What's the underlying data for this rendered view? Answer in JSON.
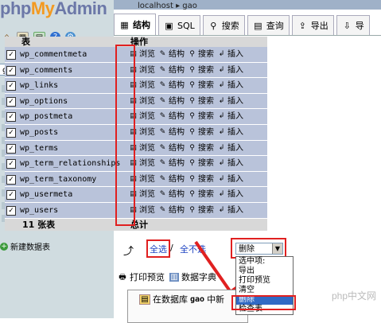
{
  "app": {
    "logo": {
      "part1": "php",
      "part2": "My",
      "part3": "Admin"
    },
    "nav_icons": [
      "home-icon",
      "table-icon",
      "query-icon",
      "help-icon",
      "settings-icon"
    ]
  },
  "left": {
    "db_selector": {
      "value": "gao"
    },
    "tables": [
      "wp_commentmeta",
      "wp_comments",
      "wp_links",
      "wp_options",
      "wp_postmeta",
      "wp_posts",
      "wp_terms",
      "wp_term_relationships",
      "wp_term_taxonomy",
      "wp_usermeta",
      "wp_users"
    ],
    "new_table": "新建数据表"
  },
  "right": {
    "breadcrumb": "localhost  ▸  gao",
    "tabs": [
      {
        "label": "结构",
        "icon": "structure-icon",
        "active": true
      },
      {
        "label": "SQL",
        "icon": "sql-icon"
      },
      {
        "label": "搜索",
        "icon": "search-icon"
      },
      {
        "label": "查询",
        "icon": "query-icon"
      },
      {
        "label": "导出",
        "icon": "export-icon"
      },
      {
        "label": "导",
        "icon": "import-icon"
      }
    ],
    "table_header": {
      "col_table": "表",
      "col_ops": "操作"
    },
    "rows": [
      {
        "name": "wp_commentmeta",
        "checked": true
      },
      {
        "name": "wp_comments",
        "checked": true
      },
      {
        "name": "wp_links",
        "checked": true
      },
      {
        "name": "wp_options",
        "checked": true
      },
      {
        "name": "wp_postmeta",
        "checked": true
      },
      {
        "name": "wp_posts",
        "checked": true
      },
      {
        "name": "wp_terms",
        "checked": true
      },
      {
        "name": "wp_term_relationships",
        "checked": true
      },
      {
        "name": "wp_term_taxonomy",
        "checked": true
      },
      {
        "name": "wp_usermeta",
        "checked": true
      },
      {
        "name": "wp_users",
        "checked": true
      }
    ],
    "row_actions": {
      "browse": "浏览",
      "structure": "结构",
      "search": "搜索",
      "insert": "插入"
    },
    "footer": {
      "count": "11 张表",
      "total": "总计"
    },
    "select_all": "全选",
    "slash": "/",
    "unselect_all": "全不选",
    "with_selected": {
      "value": "删除",
      "options": [
        "选中项:",
        "导出",
        "打印预览",
        "清空",
        "删除",
        "检查表"
      ],
      "highlighted": "删除"
    },
    "print_view": "打印预览",
    "data_dictionary": "数据字典",
    "create_table": {
      "prefix": "在数据库",
      "db": "gao",
      "suffix": "中新"
    }
  },
  "colors": {
    "row_bg": "#b9c3da",
    "highlight": "#e02020",
    "link": "#1a40c0",
    "left_bg": "#d0dce0"
  },
  "watermark": "php中文网"
}
